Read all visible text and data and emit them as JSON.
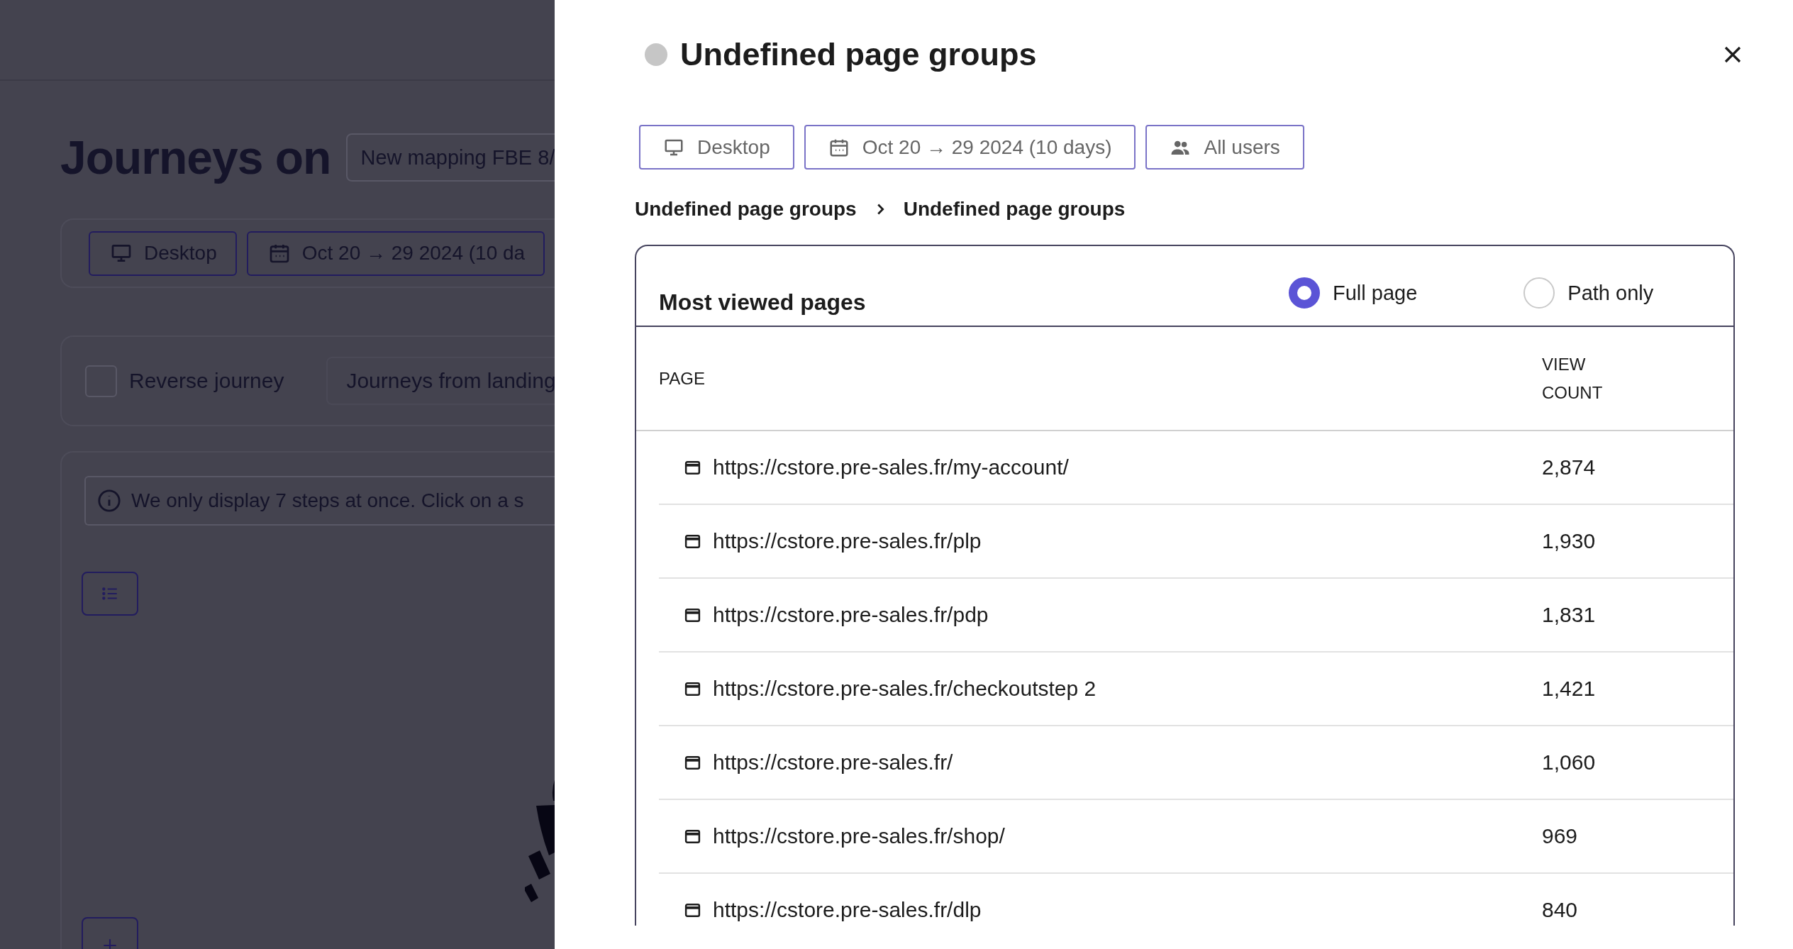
{
  "background_page": {
    "title": "Journeys on",
    "mapping_field": "New mapping FBE 8/",
    "filters": [
      {
        "kind": "device",
        "label": "Desktop"
      },
      {
        "kind": "date",
        "label": "Oct 20 → 29 2024 (10 da"
      }
    ],
    "reverse_journey": {
      "label": "Reverse journey",
      "checked": false
    },
    "journey_type": "Journeys from landing",
    "info": "We only display 7 steps at once. Click on a s"
  },
  "drawer": {
    "title": "Undefined page groups",
    "filters": [
      {
        "kind": "device",
        "label": "Desktop"
      },
      {
        "kind": "date",
        "label": "Oct 20 → 29 2024 (10 days)"
      },
      {
        "kind": "users",
        "label": "All users"
      }
    ],
    "breadcrumb": [
      "Undefined page groups",
      "Undefined page groups"
    ],
    "table": {
      "title": "Most viewed pages",
      "modes": [
        {
          "label": "Full page",
          "selected": true
        },
        {
          "label": "Path only",
          "selected": false
        }
      ],
      "columns": [
        "PAGE",
        "VIEW COUNT"
      ],
      "rows": [
        {
          "page": "https://cstore.pre-sales.fr/my-account/",
          "views": "2,874"
        },
        {
          "page": "https://cstore.pre-sales.fr/plp",
          "views": "1,930"
        },
        {
          "page": "https://cstore.pre-sales.fr/pdp",
          "views": "1,831"
        },
        {
          "page": "https://cstore.pre-sales.fr/checkoutstep 2",
          "views": "1,421"
        },
        {
          "page": "https://cstore.pre-sales.fr/",
          "views": "1,060"
        },
        {
          "page": "https://cstore.pre-sales.fr/shop/",
          "views": "969"
        },
        {
          "page": "https://cstore.pre-sales.fr/dlp",
          "views": "840"
        }
      ]
    }
  }
}
